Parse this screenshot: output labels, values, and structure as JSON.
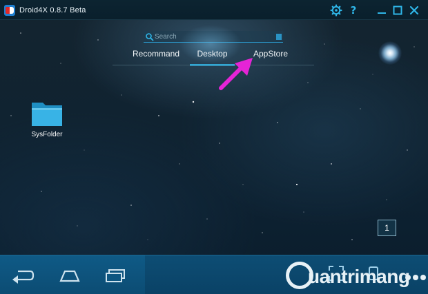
{
  "window": {
    "title": "Droid4X 0.8.7 Beta",
    "controls": [
      "gear-icon",
      "help-icon",
      "minimize-icon",
      "maximize-icon",
      "close-icon"
    ]
  },
  "search": {
    "placeholder": "Search",
    "value": ""
  },
  "tabs": [
    {
      "label": "Recommand",
      "active": false
    },
    {
      "label": "Desktop",
      "active": true
    },
    {
      "label": "AppStore",
      "active": false
    }
  ],
  "desktop": {
    "icons": [
      {
        "label": "SysFolder",
        "icon": "folder-icon"
      }
    ],
    "page_number": "1"
  },
  "navbar": {
    "buttons": [
      "back-icon",
      "home-icon",
      "recent-apps-icon"
    ],
    "tools": [
      "fullscreen-icon",
      "rotate-icon",
      "keyboard-icon",
      "more-icon"
    ]
  },
  "watermark": {
    "text": "uantrimang"
  },
  "colors": {
    "accent": "#2fb6e8",
    "arrow": "#e524d6",
    "navbar": "#0d4d74"
  }
}
